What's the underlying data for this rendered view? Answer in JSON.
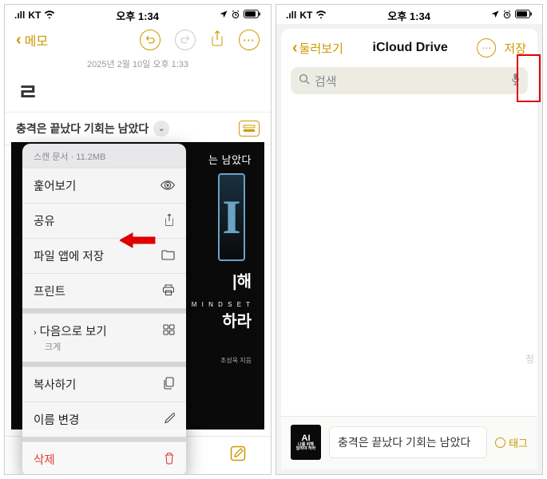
{
  "status_bar": {
    "carrier_signal": "▪▪▪▪",
    "carrier": "KT",
    "wifi": true,
    "time": "오후 1:34",
    "icons": [
      "location",
      "alarm",
      "battery"
    ]
  },
  "left": {
    "back_label": "메모",
    "timestamp": "2025년 2월 10일 오후 1:33",
    "body_snippet": "ㄹ",
    "attachment_title": "충격은 끝났다 기회는 남았다",
    "attachment_header": "스캔 문서 · 11.2MB",
    "menu": {
      "quick_look": "훑어보기",
      "share": "공유",
      "save_to_files": "파일 앱에 저장",
      "print": "프린트",
      "view_as": "다음으로 보기",
      "view_as_sub": "크게",
      "copy": "복사하기",
      "rename": "이름 변경",
      "delete": "삭제"
    },
    "book": {
      "title_line": "는 남았다",
      "line1": "|해",
      "mindset": "M I N D S E T",
      "line2": "하라",
      "author": "조성욱 지음"
    }
  },
  "right": {
    "back_label": "둘러보기",
    "title": "iCloud Drive",
    "save_label": "저장",
    "search_placeholder": "검색",
    "tag_label": "태그",
    "filename": "충격은 끝났다 기회는 남았다",
    "thumb_label": "AI",
    "side_char": "청"
  }
}
